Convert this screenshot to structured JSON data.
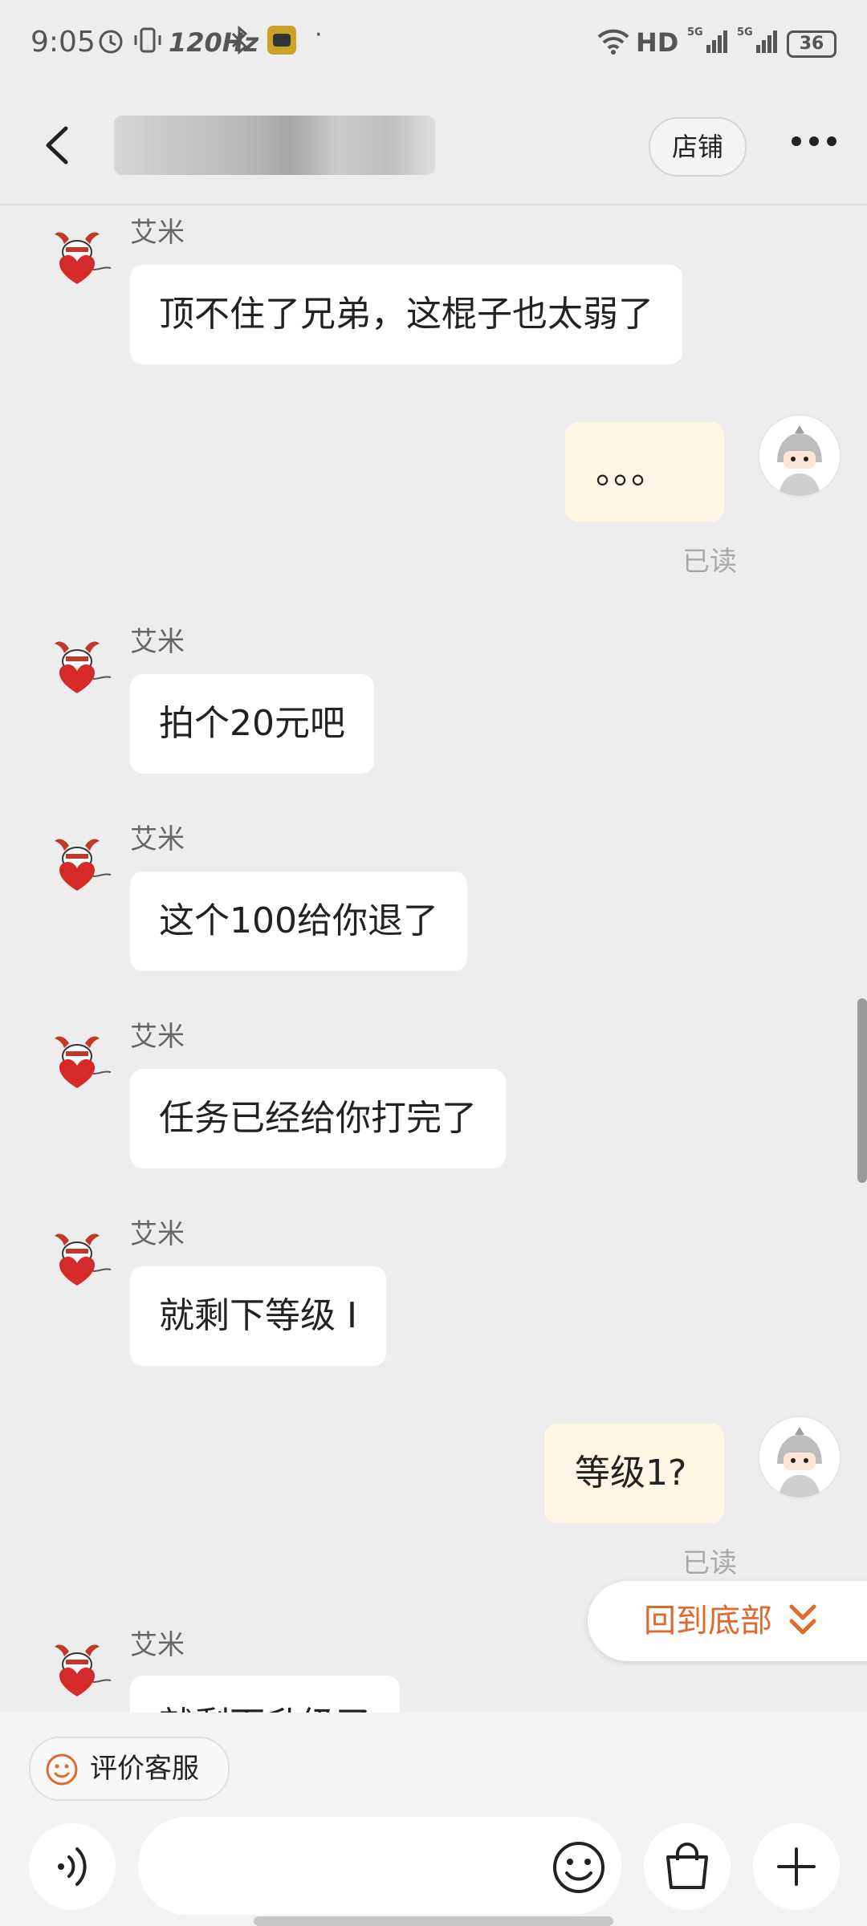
{
  "status_bar": {
    "time": "9:05",
    "refresh_rate": "120Hz",
    "network": "HD",
    "battery": "36"
  },
  "header": {
    "shop_label": "店铺"
  },
  "messages": [
    {
      "side": "left",
      "sender": "艾米",
      "text": "顶不住了兄弟，这棍子也太弱了"
    },
    {
      "side": "right",
      "text": "。。。",
      "status": "已读"
    },
    {
      "side": "left",
      "sender": "艾米",
      "text": "拍个20元吧"
    },
    {
      "side": "left",
      "sender": "艾米",
      "text": "这个100给你退了"
    },
    {
      "side": "left",
      "sender": "艾米",
      "text": "任务已经给你打完了"
    },
    {
      "side": "left",
      "sender": "艾米",
      "text": "就剩下等级 I"
    },
    {
      "side": "right",
      "text": "等级1?",
      "status": "已读"
    },
    {
      "side": "left",
      "sender": "艾米",
      "text": "就剩下升级了"
    }
  ],
  "back_to_bottom": "回到底部",
  "bottom": {
    "rate_label": "评价客服"
  },
  "colors": {
    "accent": "#e0692e",
    "bubble_self": "#fff6e6",
    "background": "#ededed"
  }
}
